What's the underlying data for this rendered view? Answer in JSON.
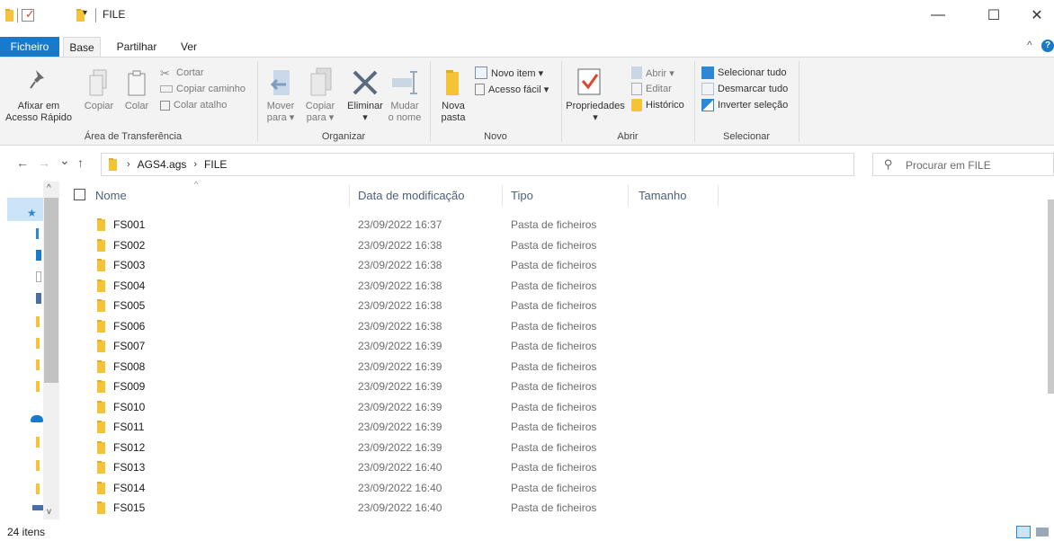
{
  "window": {
    "title": "FILE",
    "qa_dropdown": "▾",
    "minimize": "—",
    "maximize": "☐",
    "close": "✕"
  },
  "ribbon_tabs": [
    "Ficheiro",
    "Base",
    "Partilhar",
    "Ver"
  ],
  "ribbon_controls": {
    "collapse": "^",
    "help": "?"
  },
  "ribbon": {
    "clipboard": {
      "pin": "Afixar em\nAcesso Rápido",
      "copy": "Copiar",
      "paste": "Colar",
      "cut": "Cortar",
      "copy_path": "Copiar caminho",
      "paste_shortcut": "Colar atalho",
      "group": "Área de Transferência"
    },
    "organize": {
      "move_to": "Mover\npara ▾",
      "copy_to": "Copiar\npara ▾",
      "delete": "Eliminar\n▾",
      "rename": "Mudar\no nome",
      "group": "Organizar"
    },
    "new": {
      "new_folder": "Nova\npasta",
      "new_item": "Novo item ▾",
      "easy_access": "Acesso fácil ▾",
      "group": "Novo"
    },
    "open": {
      "properties": "Propriedades\n▾",
      "open": "Abrir ▾",
      "edit": "Editar",
      "history": "Histórico",
      "group": "Abrir"
    },
    "select": {
      "select_all": "Selecionar tudo",
      "select_none": "Desmarcar tudo",
      "invert": "Inverter seleção",
      "group": "Selecionar"
    }
  },
  "address": {
    "back": "←",
    "forward": "→",
    "recent": "⌄",
    "up": "↑",
    "crumbs": [
      "AGS4.ags",
      "FILE"
    ],
    "crumb_sep": "›",
    "dropdown": "⌄",
    "refresh": "↻",
    "search_placeholder": "Procurar em FILE",
    "search_icon": "⚲"
  },
  "columns": {
    "name": "Nome",
    "date": "Data de modificação",
    "type": "Tipo",
    "size": "Tamanho",
    "sort_indicator": "^"
  },
  "files": [
    {
      "name": "FS001",
      "date": "23/09/2022 16:37",
      "type": "Pasta de ficheiros"
    },
    {
      "name": "FS002",
      "date": "23/09/2022 16:38",
      "type": "Pasta de ficheiros"
    },
    {
      "name": "FS003",
      "date": "23/09/2022 16:38",
      "type": "Pasta de ficheiros"
    },
    {
      "name": "FS004",
      "date": "23/09/2022 16:38",
      "type": "Pasta de ficheiros"
    },
    {
      "name": "FS005",
      "date": "23/09/2022 16:38",
      "type": "Pasta de ficheiros"
    },
    {
      "name": "FS006",
      "date": "23/09/2022 16:38",
      "type": "Pasta de ficheiros"
    },
    {
      "name": "FS007",
      "date": "23/09/2022 16:39",
      "type": "Pasta de ficheiros"
    },
    {
      "name": "FS008",
      "date": "23/09/2022 16:39",
      "type": "Pasta de ficheiros"
    },
    {
      "name": "FS009",
      "date": "23/09/2022 16:39",
      "type": "Pasta de ficheiros"
    },
    {
      "name": "FS010",
      "date": "23/09/2022 16:39",
      "type": "Pasta de ficheiros"
    },
    {
      "name": "FS011",
      "date": "23/09/2022 16:39",
      "type": "Pasta de ficheiros"
    },
    {
      "name": "FS012",
      "date": "23/09/2022 16:39",
      "type": "Pasta de ficheiros"
    },
    {
      "name": "FS013",
      "date": "23/09/2022 16:40",
      "type": "Pasta de ficheiros"
    },
    {
      "name": "FS014",
      "date": "23/09/2022 16:40",
      "type": "Pasta de ficheiros"
    },
    {
      "name": "FS015",
      "date": "23/09/2022 16:40",
      "type": "Pasta de ficheiros"
    }
  ],
  "navpane_scroll": {
    "up": "^",
    "down": "v"
  },
  "status": {
    "item_count": "24 itens"
  },
  "colors": {
    "accent": "#1979ca",
    "folder": "#f5c337",
    "selection": "#cce4f7"
  }
}
